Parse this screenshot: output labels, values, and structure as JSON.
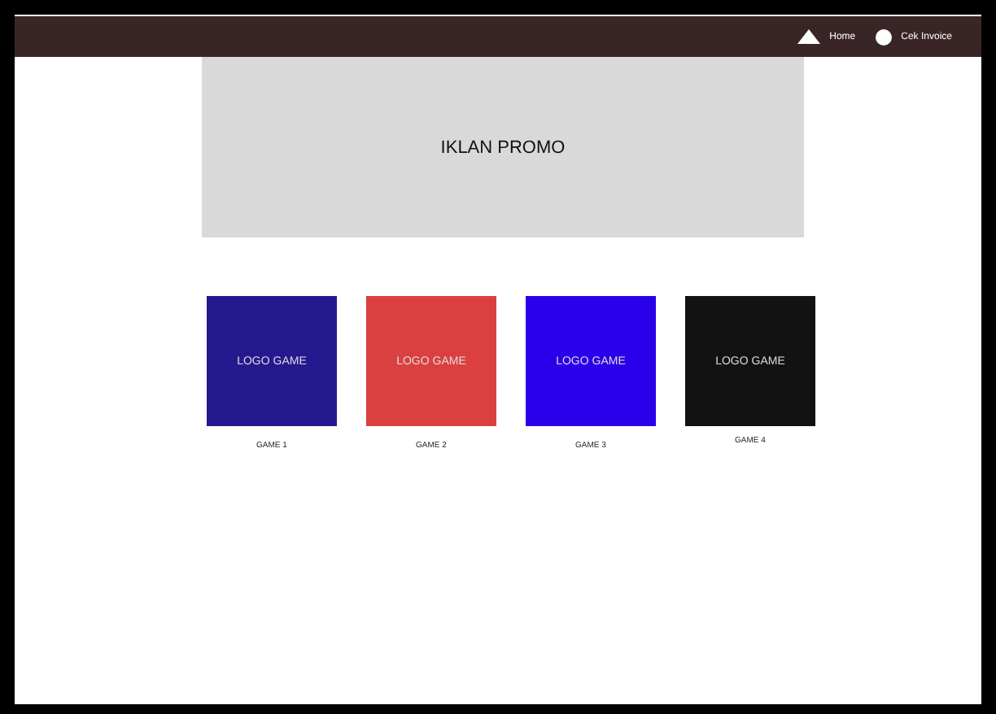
{
  "nav": [
    {
      "label": "Home",
      "kind": "triangle"
    },
    {
      "label": "Cek Invoice",
      "kind": "circle"
    }
  ],
  "promo": {
    "text": "IKLAN PROMO"
  },
  "games": [
    {
      "logo": "LOGO GAME",
      "name": "GAME 1",
      "color": "#26198f"
    },
    {
      "logo": "LOGO GAME",
      "name": "GAME 2",
      "color": "#db4040"
    },
    {
      "logo": "LOGO GAME",
      "name": "GAME 3",
      "color": "#2a00ea"
    },
    {
      "logo": "LOGO GAME",
      "name": "GAME 4",
      "color": "#121212"
    }
  ]
}
